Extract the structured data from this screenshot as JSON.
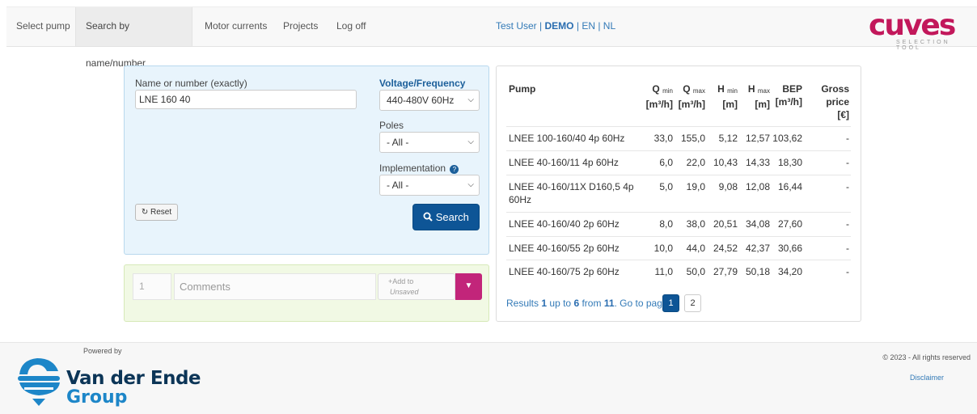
{
  "nav": {
    "items": [
      "Select pump",
      "Search by name/number",
      "Motor currents",
      "Projects",
      "Log off"
    ],
    "user": "Test User",
    "separator": "|",
    "env": "DEMO",
    "lang_en": "EN",
    "lang_nl": "NL"
  },
  "logo": {
    "text": "cuves",
    "subtitle": "SELECTION TOOL"
  },
  "search": {
    "name_label": "Name or number (exactly)",
    "name_value": "LNE 160 40",
    "voltage_label": "Voltage/Frequency",
    "voltage_value": "440-480V 60Hz",
    "poles_label": "Poles",
    "poles_value": "- All -",
    "impl_label": "Implementation",
    "impl_value": "- All -",
    "reset_label": "Reset",
    "search_label": "Search"
  },
  "comment": {
    "qty_placeholder": "1",
    "comments_placeholder": "Comments",
    "add_label": "Add to",
    "add_target": "Unsaved"
  },
  "results": {
    "headers": {
      "pump": "Pump",
      "qmin": "Q",
      "qmin_sub": "min",
      "qmin_unit": "[m³/h]",
      "qmax": "Q",
      "qmax_sub": "max",
      "qmax_unit": "[m³/h]",
      "hmin": "H",
      "hmin_sub": "min",
      "hmin_unit": "[m]",
      "hmax": "H",
      "hmax_sub": "max",
      "hmax_unit": "[m]",
      "bep": "BEP",
      "bep_unit": "[m³/h]",
      "price_1": "Gross",
      "price_2": "price",
      "price_3": "[€]"
    },
    "rows": [
      {
        "pump": "LNEE 100-160/40 4p 60Hz",
        "pump2": "",
        "qmin": "33,0",
        "qmax": "155,0",
        "hmin": "5,12",
        "hmax": "12,57",
        "bep": "103,62",
        "price": "-"
      },
      {
        "pump": "LNEE 40-160/11 4p 60Hz",
        "pump2": "",
        "qmin": "6,0",
        "qmax": "22,0",
        "hmin": "10,43",
        "hmax": "14,33",
        "bep": "18,30",
        "price": "-"
      },
      {
        "pump": "LNEE 40-160/11X D160,5 4p",
        "pump2": "60Hz",
        "qmin": "5,0",
        "qmax": "19,0",
        "hmin": "9,08",
        "hmax": "12,08",
        "bep": "16,44",
        "price": "-"
      },
      {
        "pump": "LNEE 40-160/40 2p 60Hz",
        "pump2": "",
        "qmin": "8,0",
        "qmax": "38,0",
        "hmin": "20,51",
        "hmax": "34,08",
        "bep": "27,60",
        "price": "-"
      },
      {
        "pump": "LNEE 40-160/55 2p 60Hz",
        "pump2": "",
        "qmin": "10,0",
        "qmax": "44,0",
        "hmin": "24,52",
        "hmax": "42,37",
        "bep": "30,66",
        "price": "-"
      },
      {
        "pump": "LNEE 40-160/75 2p 60Hz",
        "pump2": "",
        "qmin": "11,0",
        "qmax": "50,0",
        "hmin": "27,79",
        "hmax": "50,18",
        "bep": "34,20",
        "price": "-"
      }
    ],
    "pager": {
      "prefix": "Results",
      "from": "1",
      "mid": "up to",
      "to": "6",
      "of_word": "from",
      "total": "11",
      "suffix": ". Go to page:",
      "pages": [
        "1",
        "2"
      ]
    }
  },
  "footer": {
    "powered": "Powered by",
    "brand_1": "Van der Ende",
    "brand_2": "Group",
    "copyright": "© 2023 - All rights reserved",
    "disclaimer": "Disclaimer"
  },
  "colors": {
    "accent": "#0e5596",
    "brand": "#c2257a",
    "panel_blue": "#e8f4fc",
    "panel_green": "#f1f9e4"
  }
}
